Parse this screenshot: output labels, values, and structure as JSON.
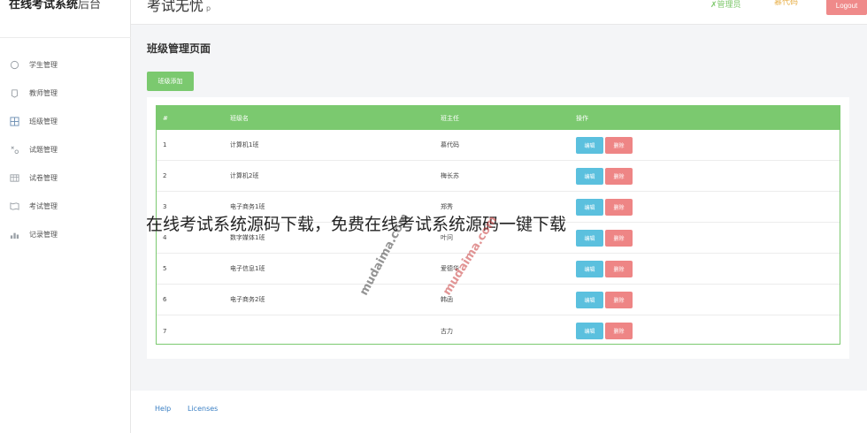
{
  "sidebar": {
    "brand": "在线考试系统",
    "brand_suffix": "后台",
    "items": [
      {
        "label": "学生管理",
        "icon": "student-icon"
      },
      {
        "label": "教师管理",
        "icon": "teacher-icon"
      },
      {
        "label": "班级管理",
        "icon": "grid-icon"
      },
      {
        "label": "试题管理",
        "icon": "question-icon"
      },
      {
        "label": "试卷管理",
        "icon": "paper-icon"
      },
      {
        "label": "考试管理",
        "icon": "exam-icon"
      },
      {
        "label": "记录管理",
        "icon": "record-icon"
      }
    ]
  },
  "topbar": {
    "title": "考试无忧",
    "title_tag": "p",
    "admin_label": "✗管理员",
    "user_label": "慕代码",
    "logout_label": "Logout"
  },
  "page": {
    "title": "班级管理页面",
    "add_button": "班级添加"
  },
  "table": {
    "headers": [
      "#",
      "班级名",
      "班主任",
      "操作"
    ],
    "rows": [
      {
        "id": "1",
        "name": "计算机1班",
        "teacher": "慕代码"
      },
      {
        "id": "2",
        "name": "计算机2班",
        "teacher": "梅长苏"
      },
      {
        "id": "3",
        "name": "电子商务1班",
        "teacher": "郑秀"
      },
      {
        "id": "4",
        "name": "数字媒体1班",
        "teacher": "叶问"
      },
      {
        "id": "5",
        "name": "电子信息1班",
        "teacher": "爱德华"
      },
      {
        "id": "6",
        "name": "电子商务2班",
        "teacher": "韩函"
      },
      {
        "id": "7",
        "name": "",
        "teacher": "古力"
      }
    ],
    "edit_label": "编辑",
    "delete_label": "删除"
  },
  "footer": {
    "help": "Help",
    "licenses": "Licenses"
  },
  "overlay": {
    "caption": "在线考试系统源码下载，免费在线考试系统源码一键下载",
    "watermark1": "mudaima.com",
    "watermark2": "mudaima.com"
  },
  "colors": {
    "accent_green": "#7bc96f",
    "edit_blue": "#5bc0de",
    "delete_red": "#ee8585",
    "logout_red": "#ef8a8a"
  }
}
